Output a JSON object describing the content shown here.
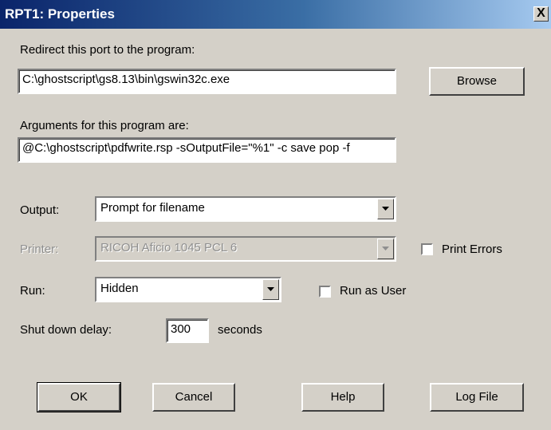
{
  "window": {
    "title": "RPT1: Properties",
    "close_label": "X"
  },
  "redirect": {
    "label": "Redirect this port to the program:",
    "value": "C:\\ghostscript\\gs8.13\\bin\\gswin32c.exe",
    "browse_label": "Browse"
  },
  "arguments": {
    "label": "Arguments for this program are:",
    "value": "@C:\\ghostscript\\pdfwrite.rsp -sOutputFile=\"%1\" -c save pop -f"
  },
  "output": {
    "label": "Output:",
    "selected": "Prompt for filename"
  },
  "printer": {
    "label": "Printer:",
    "selected": "RICOH Aficio 1045 PCL 6",
    "print_errors_label": "Print Errors"
  },
  "run": {
    "label": "Run:",
    "selected": "Hidden",
    "run_as_user_label": "Run as User"
  },
  "shutdown": {
    "label": "Shut down delay:",
    "value": "300",
    "unit": "seconds"
  },
  "buttons": {
    "ok": "OK",
    "cancel": "Cancel",
    "help": "Help",
    "log_file": "Log File"
  }
}
